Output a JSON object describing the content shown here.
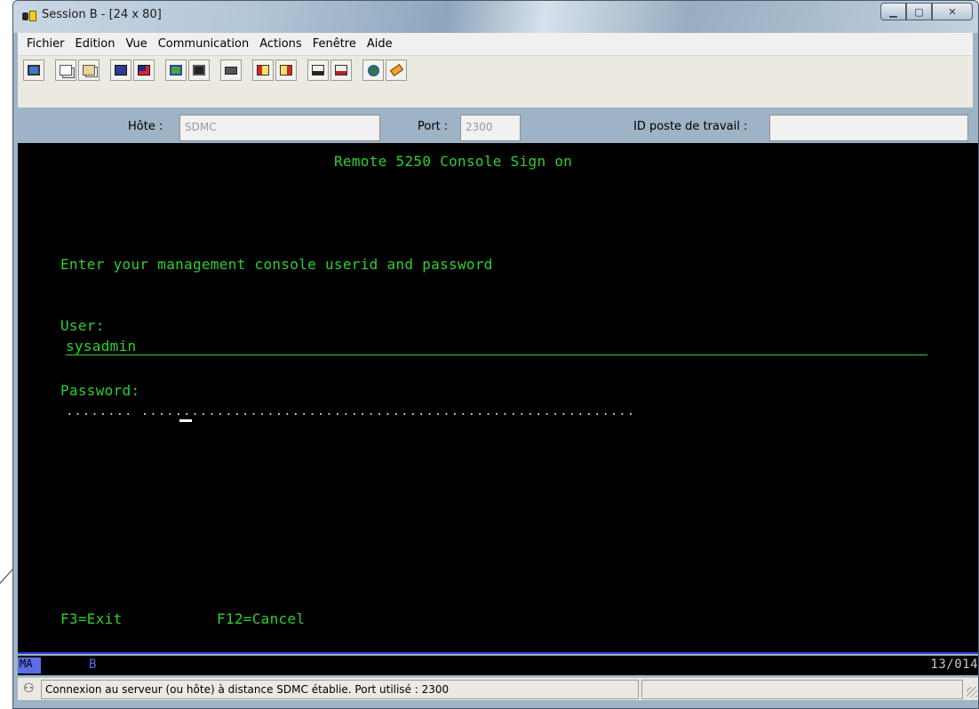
{
  "window": {
    "title": "Session B - [24 x 80]",
    "controls": [
      "minimize",
      "maximize",
      "close"
    ]
  },
  "menu": [
    "Fichier",
    "Edition",
    "Vue",
    "Communication",
    "Actions",
    "Fenêtre",
    "Aide"
  ],
  "toolbar": {
    "icons": [
      "display-icon",
      "copy-icon",
      "paste-icon",
      "send-icon",
      "receive-icon",
      "display-setup-icon",
      "terminal-icon",
      "keyboard-icon",
      "record-macro-icon",
      "stop-macro-icon",
      "play-macro-icon",
      "play-macro2-icon",
      "globe-icon",
      "tag-icon"
    ]
  },
  "connection": {
    "host_label": "Hôte :",
    "host_value": "SDMC",
    "port_label": "Port :",
    "port_value": "2300",
    "workstation_label": "ID poste de travail :",
    "workstation_value": ""
  },
  "terminal": {
    "title": "Remote 5250 Console Sign on",
    "prompt": "Enter your management console userid and password",
    "user_label": "User:",
    "user_value": "sysadmin",
    "password_label": "Password:",
    "password_dots": "........ ...........................................................",
    "f3": "F3=Exit",
    "f12": "F12=Cancel"
  },
  "oia": {
    "mode": "MA",
    "session": "B",
    "cursor_position": "13/014"
  },
  "status": {
    "message": "Connexion au serveur (ou hôte) à distance SDMC établie. Port utilisé : 2300"
  },
  "colors": {
    "terminal_bg": "#000000",
    "terminal_text": "#2fcf2f",
    "oia_accent": "#5a6ee8"
  }
}
